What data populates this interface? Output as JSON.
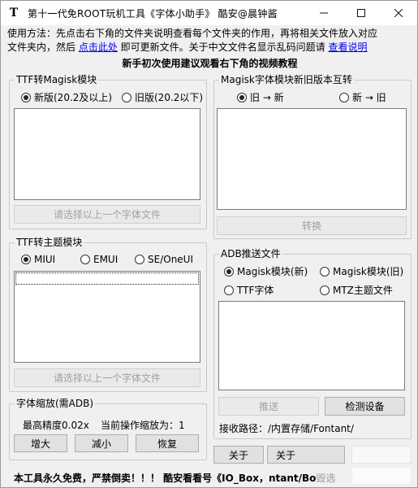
{
  "window": {
    "title": "第十一代免ROOT玩机工具《字体小助手》 酷安@晨钟酱",
    "icon_glyph": "T"
  },
  "instructions": {
    "part1": "使用方法：先点击右下角的文件夹说明查看每个文件夹的作用，再将相关文件放入对应",
    "part2": "文件夹内，然后 ",
    "link_click": "点击此处",
    "part3": " 即可更新文件。关于中文文件名显示乱码问题请 ",
    "link_help": "查看说明",
    "bold_note": "新手初次使用建议观看右下角的视频教程"
  },
  "ttf_magisk": {
    "title": "TTF转Magisk模块",
    "radio_new": "新版(20.2及以上)",
    "radio_old": "旧版(20.2以下)",
    "button": "请选择以上一个字体文件"
  },
  "magisk_convert": {
    "title": "Magisk字体模块新旧版本互转",
    "radio_old_to_new": "旧 → 新",
    "radio_new_to_old": "新 → 旧",
    "button": "转换"
  },
  "ttf_theme": {
    "title": "TTF转主题模块",
    "radio_miui": "MIUI",
    "radio_emui": "EMUI",
    "radio_se": "SE/OneUI",
    "button": "请选择以上一个字体文件"
  },
  "adb_push": {
    "title": "ADB推送文件",
    "radio_magisk_new": "Magisk模块(新)",
    "radio_magisk_old": "Magisk模块(旧)",
    "radio_ttf": "TTF字体",
    "radio_mtz": "MTZ主题文件",
    "push_button": "推送",
    "detect_button": "检测设备",
    "path_label": "接收路径：/内置存储/Fontant/"
  },
  "font_scale": {
    "title": "字体缩放(需ADB)",
    "precision": "最高精度0.02x",
    "current": "当前操作缩放为：1",
    "enlarge": "增大",
    "shrink": "减小",
    "restore": "恢复"
  },
  "bottom": {
    "about1": "关于",
    "about2": "关于",
    "footer": "本工具永久免费，严禁倒卖！！！  酷安看看号《IO_Box，ntant/Bo",
    "footer_tail": "毁选"
  }
}
